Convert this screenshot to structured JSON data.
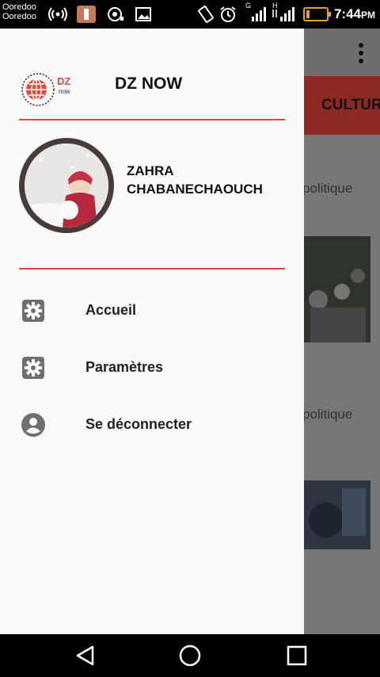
{
  "status_bar": {
    "carrier_1": "Ooredoo",
    "carrier_2": "Ooredoo",
    "time": "7:44",
    "ampm": "PM",
    "sim_icon_1": "G",
    "sim_icon_2": "H"
  },
  "app": {
    "tab_label": "CULTUR",
    "bg_text_1": "politique",
    "bg_text_2": "politique"
  },
  "drawer": {
    "brand": {
      "logo_text": "DZ",
      "logo_subtext": "now",
      "title": "DZ NOW"
    },
    "user": {
      "name_line1": "ZAHRA",
      "name_line2": "CHABANECHAOUCH"
    },
    "menu": [
      {
        "label": "Accueil",
        "icon": "settings-icon"
      },
      {
        "label": "Paramètres",
        "icon": "settings-icon"
      },
      {
        "label": "Se déconnecter",
        "icon": "account-circle-icon"
      }
    ]
  },
  "colors": {
    "accent": "#e04a3c",
    "drawer_bg": "#fafafa",
    "scrim": "#777777",
    "tab_strip": "#8b2a22"
  }
}
